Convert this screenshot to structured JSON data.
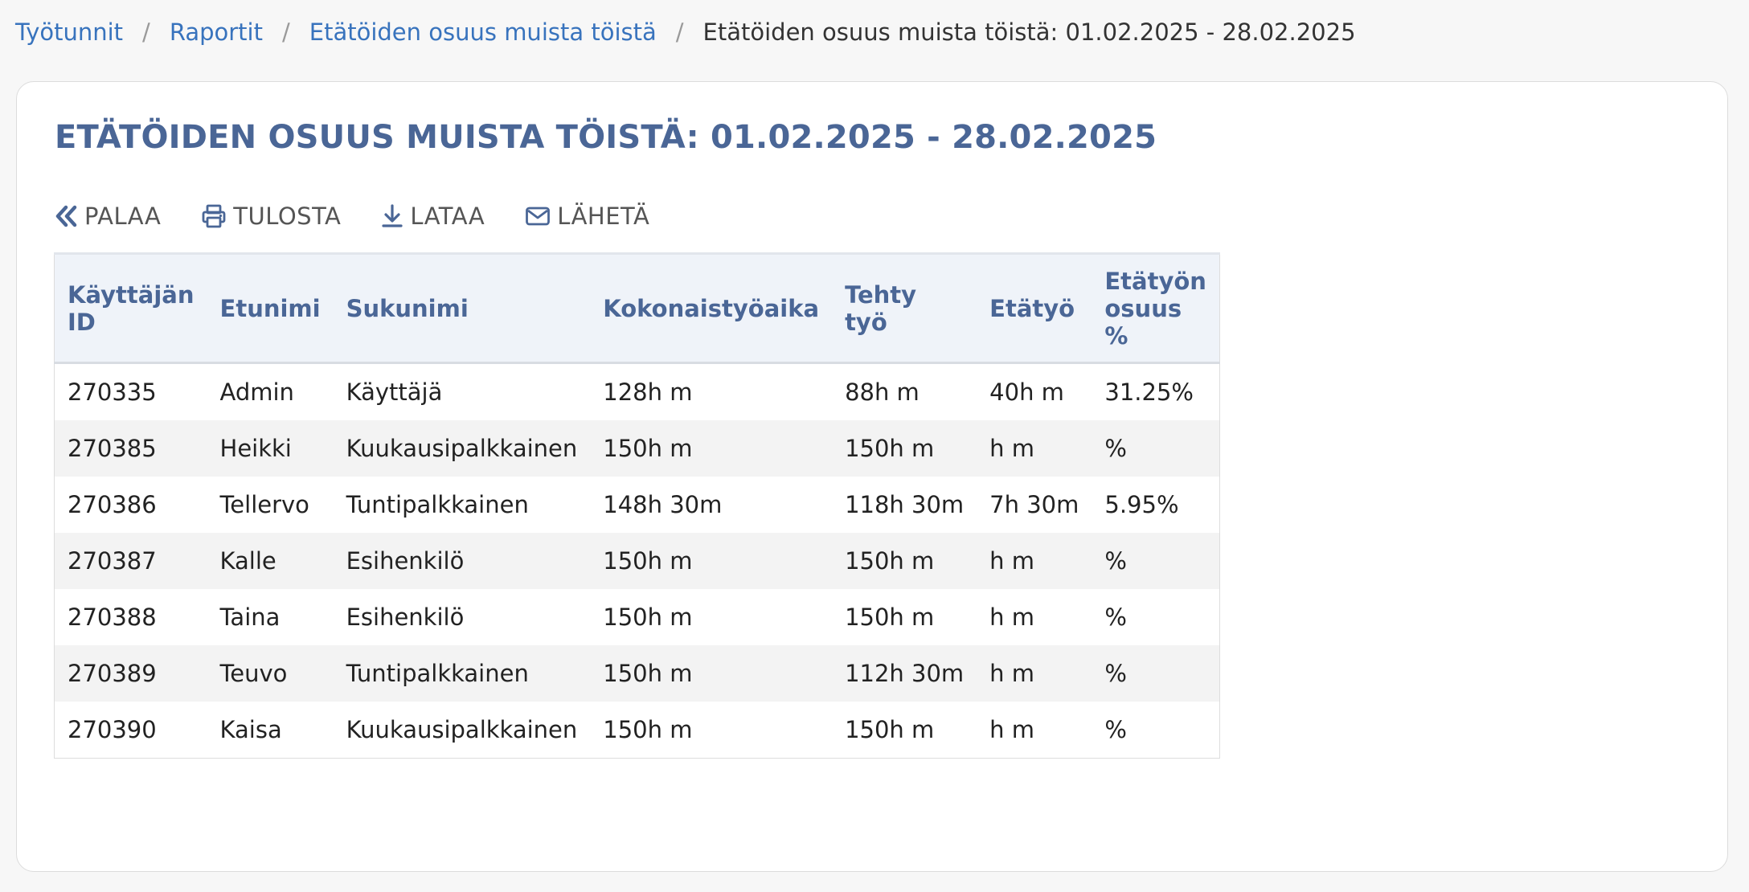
{
  "breadcrumb": {
    "items": [
      "Työtunnit",
      "Raportit",
      "Etätöiden osuus muista töistä"
    ],
    "separator": "/",
    "current": "Etätöiden osuus muista töistä: 01.02.2025 - 28.02.2025"
  },
  "page": {
    "title": "ETÄTÖIDEN OSUUS MUISTA TÖISTÄ: 01.02.2025 - 28.02.2025"
  },
  "toolbar": {
    "back_label": "PALAA",
    "print_label": "TULOSTA",
    "download_label": "LATAA",
    "send_label": "LÄHETÄ"
  },
  "icons": {
    "back": "double-chevron-left-icon",
    "print": "printer-icon",
    "download": "download-icon",
    "send": "envelope-icon"
  },
  "colors": {
    "link": "#3873bd",
    "heading": "#4a6696",
    "header_bg": "#eff3f9",
    "row_alt_bg": "#f3f3f3"
  },
  "table": {
    "headers": [
      "Käyttäjän ID",
      "Etunimi",
      "Sukunimi",
      "Kokonaistyöaika",
      "Tehty työ",
      "Etätyö",
      "Etätyön osuus %"
    ],
    "rows": [
      [
        "270335",
        "Admin",
        "Käyttäjä",
        "128h m",
        "88h m",
        "40h m",
        "31.25%"
      ],
      [
        "270385",
        "Heikki",
        "Kuukausipalkkainen",
        "150h m",
        "150h m",
        "h m",
        "%"
      ],
      [
        "270386",
        "Tellervo",
        "Tuntipalkkainen",
        "148h 30m",
        "118h 30m",
        "7h 30m",
        "5.95%"
      ],
      [
        "270387",
        "Kalle",
        "Esihenkilö",
        "150h m",
        "150h m",
        "h m",
        "%"
      ],
      [
        "270388",
        "Taina",
        "Esihenkilö",
        "150h m",
        "150h m",
        "h m",
        "%"
      ],
      [
        "270389",
        "Teuvo",
        "Tuntipalkkainen",
        "150h m",
        "112h 30m",
        "h m",
        "%"
      ],
      [
        "270390",
        "Kaisa",
        "Kuukausipalkkainen",
        "150h m",
        "150h m",
        "h m",
        "%"
      ]
    ]
  }
}
